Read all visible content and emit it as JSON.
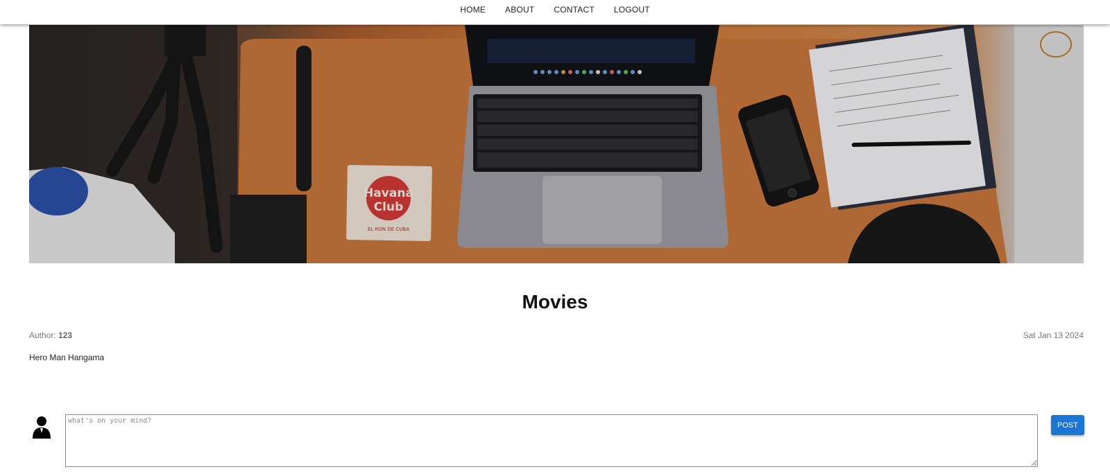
{
  "nav": {
    "items": [
      {
        "label": "HOME"
      },
      {
        "label": "ABOUT"
      },
      {
        "label": "CONTACT"
      },
      {
        "label": "LOGOUT"
      }
    ]
  },
  "banner": {
    "description_icon": "desk-laptop-image",
    "coaster_text_1": "Havana",
    "coaster_text_2": "Club",
    "coaster_text_3": "EL RON DE CUBA"
  },
  "post": {
    "title": "Movies",
    "author_label": "Author:",
    "author_name": "123",
    "date": "Sat Jan 13 2024",
    "body": "Hero Man Hangama"
  },
  "comment": {
    "avatar_icon": "user-avatar-icon",
    "placeholder": "what's on your mind?",
    "value": "",
    "post_label": "POST"
  },
  "colors": {
    "accent": "#1976d2",
    "desk": "#cf7f41"
  }
}
